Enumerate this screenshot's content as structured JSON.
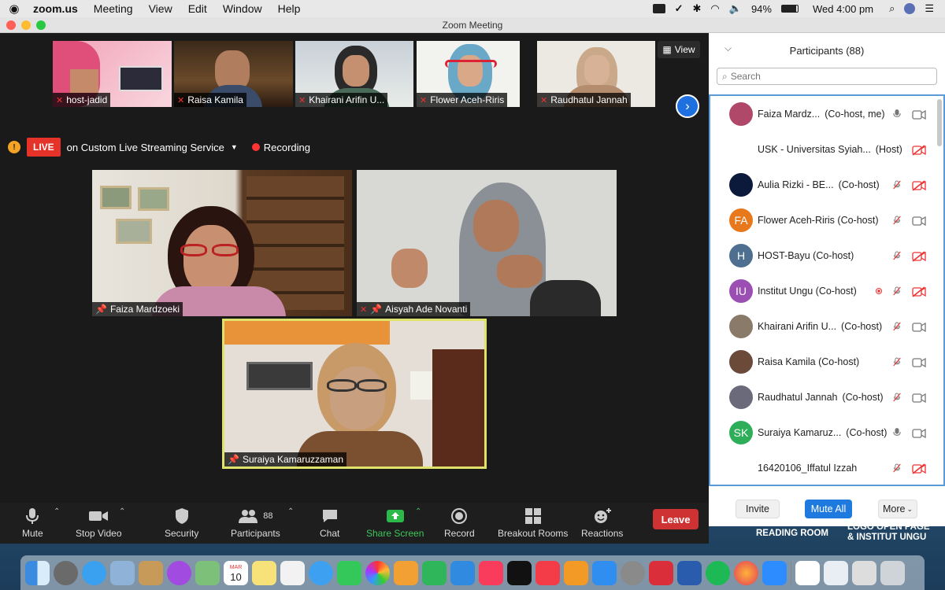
{
  "menubar": {
    "app": "zoom.us",
    "items": [
      "Meeting",
      "View",
      "Edit",
      "Window",
      "Help"
    ],
    "battery": "94%",
    "clock": "Wed 4:00 pm"
  },
  "window": {
    "title": "Zoom Meeting"
  },
  "gallery": {
    "thumbs": [
      {
        "label": "host-jadid"
      },
      {
        "label": "Raisa Kamila"
      },
      {
        "label": "Khairani Arifin U..."
      },
      {
        "label": "Flower Aceh-Riris"
      },
      {
        "label": "Raudhatul Jannah"
      }
    ],
    "view_label": "View"
  },
  "live": {
    "badge": "LIVE",
    "service": "on Custom Live Streaming Service",
    "recording": "Recording"
  },
  "tiles": [
    {
      "label": "Faiza Mardzoeki"
    },
    {
      "label": "Aisyah Ade Novanti"
    },
    {
      "label": "Suraiya Kamaruzzaman"
    }
  ],
  "toolbar": {
    "mute": "Mute",
    "stop_video": "Stop Video",
    "security": "Security",
    "participants": "Participants",
    "participants_count": "88",
    "chat": "Chat",
    "share_screen": "Share Screen",
    "record": "Record",
    "breakout": "Breakout Rooms",
    "reactions": "Reactions",
    "leave": "Leave"
  },
  "panel": {
    "title": "Participants (88)",
    "search_placeholder": "Search",
    "participants": [
      {
        "name": "Faiza Mardz...",
        "role": "(Co-host, me)",
        "initials": "",
        "color": "#b0486a",
        "mic": "on",
        "cam": "on"
      },
      {
        "name": "USK - Universitas Syiah...",
        "role": "(Host)",
        "initials": "",
        "color": "#ffffff",
        "mic": "none",
        "cam": "off"
      },
      {
        "name": "Aulia Rizki - BE...",
        "role": "(Co-host)",
        "initials": "",
        "color": "#0b1a3a",
        "mic": "off",
        "cam": "off"
      },
      {
        "name": "Flower Aceh-Riris (Co-host)",
        "role": "",
        "initials": "FA",
        "color": "#e8781c",
        "mic": "off",
        "cam": "on"
      },
      {
        "name": "HOST-Bayu (Co-host)",
        "role": "",
        "initials": "H",
        "color": "#4e6f8f",
        "mic": "off",
        "cam": "off"
      },
      {
        "name": "Institut Ungu (Co-host)",
        "role": "",
        "initials": "IU",
        "color": "#9b4fb3",
        "mic": "off",
        "cam": "off"
      },
      {
        "name": "Khairani Arifin U...",
        "role": "(Co-host)",
        "initials": "",
        "color": "#8a7a6a",
        "mic": "off",
        "cam": "on"
      },
      {
        "name": "Raisa Kamila (Co-host)",
        "role": "",
        "initials": "",
        "color": "#6b4a3a",
        "mic": "off",
        "cam": "on"
      },
      {
        "name": "Raudhatul Jannah",
        "role": "(Co-host)",
        "initials": "",
        "color": "#6a6a7a",
        "mic": "off",
        "cam": "on"
      },
      {
        "name": "Suraiya Kamaruz...",
        "role": "(Co-host)",
        "initials": "SK",
        "color": "#2fae5a",
        "mic": "on",
        "cam": "on"
      },
      {
        "name": "16420106_Iffatul Izzah",
        "role": "",
        "initials": "",
        "color": "#ffffff",
        "mic": "off",
        "cam": "off"
      }
    ],
    "invite": "Invite",
    "mute_all": "Mute All",
    "more": "More"
  },
  "desktop": {
    "reading_room": "READING ROOM",
    "logo_line1": "LOGO OPEN PAGE",
    "logo_line2": "& INSTITUT UNGU"
  },
  "dock": {
    "calendar_month": "MAR",
    "calendar_day": "10"
  }
}
